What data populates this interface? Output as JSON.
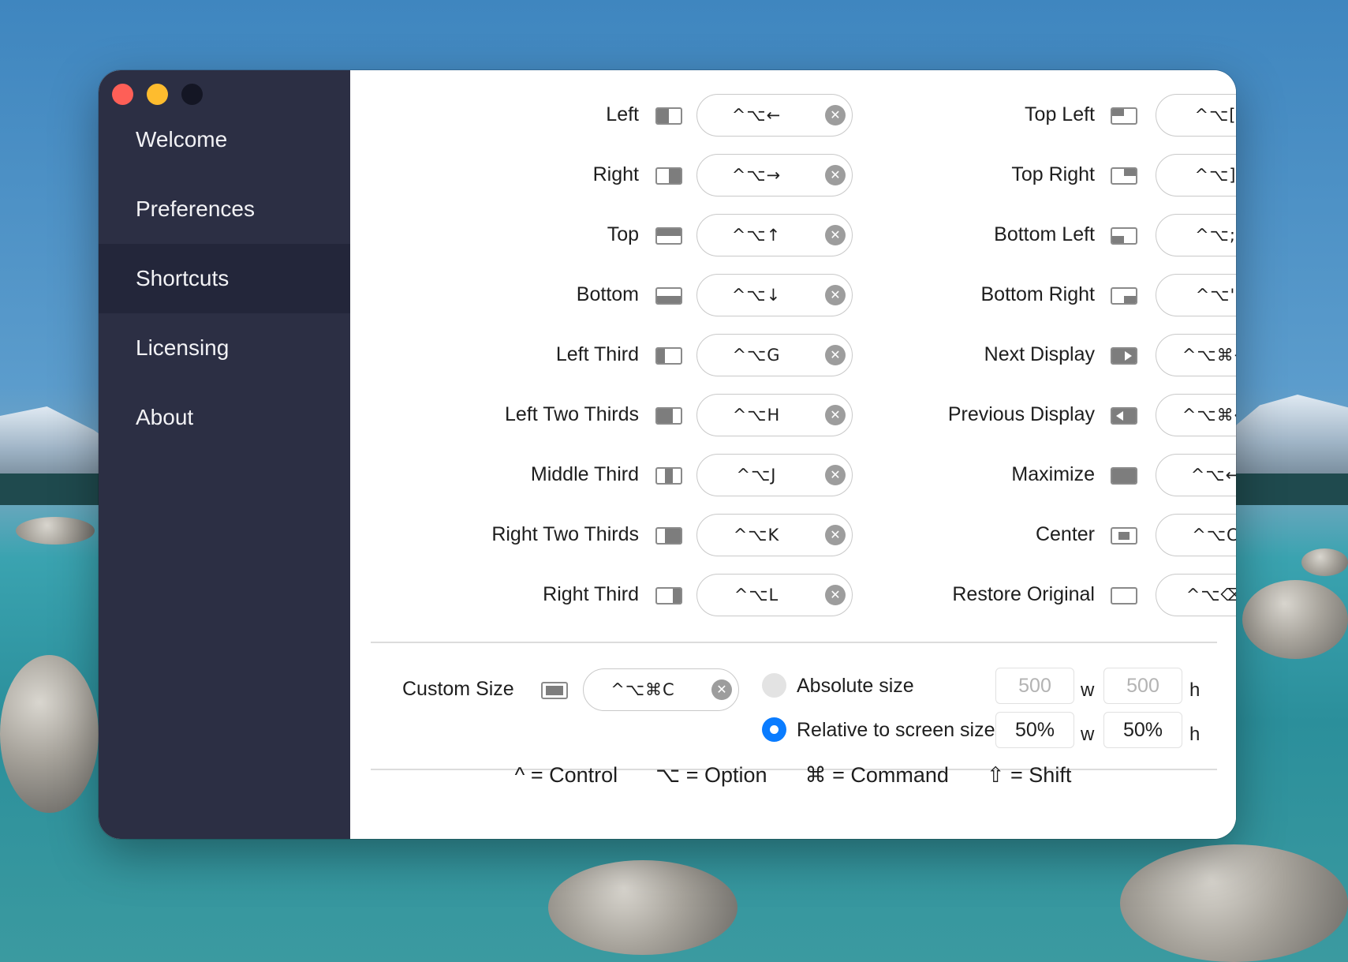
{
  "sidebar": {
    "items": [
      {
        "label": "Welcome",
        "active": false
      },
      {
        "label": "Preferences",
        "active": false
      },
      {
        "label": "Shortcuts",
        "active": true
      },
      {
        "label": "Licensing",
        "active": false
      },
      {
        "label": "About",
        "active": false
      }
    ]
  },
  "shortcuts_left": [
    {
      "label": "Left",
      "key": "^⌥←",
      "icon": "left-half-icon"
    },
    {
      "label": "Right",
      "key": "^⌥→",
      "icon": "right-half-icon"
    },
    {
      "label": "Top",
      "key": "^⌥↑",
      "icon": "top-half-icon"
    },
    {
      "label": "Bottom",
      "key": "^⌥↓",
      "icon": "bottom-half-icon"
    },
    {
      "label": "Left Third",
      "key": "^⌥G",
      "icon": "left-third-icon"
    },
    {
      "label": "Left Two Thirds",
      "key": "^⌥H",
      "icon": "left-two-thirds-icon"
    },
    {
      "label": "Middle Third",
      "key": "^⌥J",
      "icon": "middle-third-icon"
    },
    {
      "label": "Right Two Thirds",
      "key": "^⌥K",
      "icon": "right-two-thirds-icon"
    },
    {
      "label": "Right Third",
      "key": "^⌥L",
      "icon": "right-third-icon"
    }
  ],
  "shortcuts_right": [
    {
      "label": "Top Left",
      "key": "^⌥[",
      "icon": "top-left-icon"
    },
    {
      "label": "Top Right",
      "key": "^⌥]",
      "icon": "top-right-icon"
    },
    {
      "label": "Bottom Left",
      "key": "^⌥;",
      "icon": "bottom-left-icon"
    },
    {
      "label": "Bottom Right",
      "key": "^⌥'",
      "icon": "bottom-right-icon"
    },
    {
      "label": "Next Display",
      "key": "^⌥⌘→",
      "icon": "next-display-icon"
    },
    {
      "label": "Previous Display",
      "key": "^⌥⌘←",
      "icon": "previous-display-icon"
    },
    {
      "label": "Maximize",
      "key": "^⌥↩",
      "icon": "maximize-icon"
    },
    {
      "label": "Center",
      "key": "^⌥C",
      "icon": "center-icon"
    },
    {
      "label": "Restore Original",
      "key": "^⌥⌫",
      "icon": "restore-icon"
    }
  ],
  "custom_size": {
    "label": "Custom Size",
    "key": "^⌥⌘C",
    "absolute_label": "Absolute size",
    "absolute_selected": false,
    "absolute_w": "500",
    "absolute_h": "500",
    "relative_label": "Relative to screen size",
    "relative_selected": true,
    "relative_w": "50%",
    "relative_h": "50%",
    "w_unit": "w",
    "h_unit": "h"
  },
  "clear_glyph": "✕",
  "legend": {
    "control": "^ = Control",
    "option": "⌥ = Option",
    "command": "⌘ = Command",
    "shift": "⇧ = Shift"
  }
}
